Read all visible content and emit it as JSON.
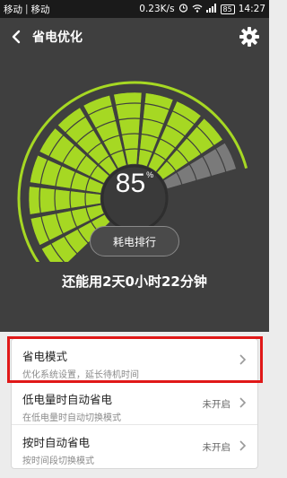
{
  "status_bar": {
    "carrier1": "移动",
    "carrier2": "移动",
    "speed": "0.23K/s",
    "battery": "85",
    "time": "14:27"
  },
  "header": {
    "title": "省电优化"
  },
  "gauge": {
    "percent": "85",
    "percent_symbol": "%",
    "level": 0.85
  },
  "rank_button": {
    "label": "耗电排行"
  },
  "remaining_time": "还能用2天0小时22分钟",
  "list": [
    {
      "title": "省电模式",
      "subtitle": "优化系统设置，延长待机时间",
      "status": ""
    },
    {
      "title": "低电量时自动省电",
      "subtitle": "在低电量时自动切换模式",
      "status": "未开启"
    },
    {
      "title": "按时自动省电",
      "subtitle": "按时间段切换模式",
      "status": "未开启"
    }
  ],
  "colors": {
    "accent_green": "#a6d823",
    "dark_bg": "#3f3f3f",
    "highlight": "#e01818"
  }
}
